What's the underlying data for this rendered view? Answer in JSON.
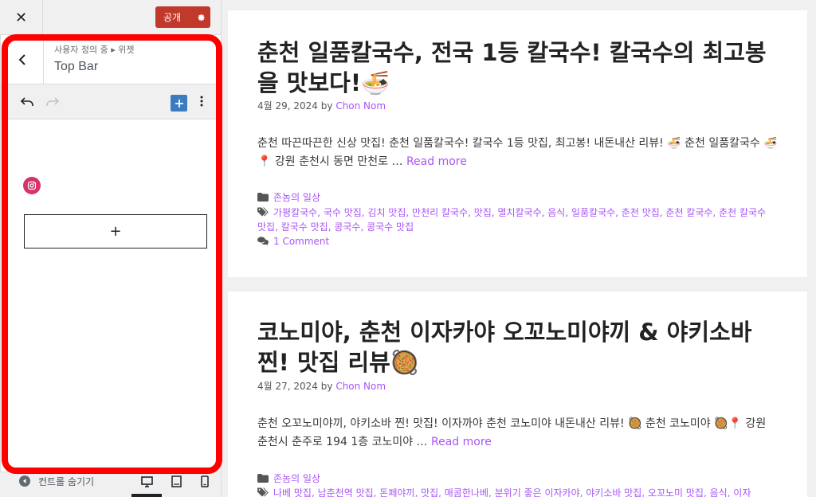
{
  "sidebar": {
    "publish_label": "공개",
    "breadcrumb": "사용자 정의 중 ▸ 위젯",
    "panel_title": "Top Bar",
    "appender_label": "+",
    "collapse_label": "컨트롤 숨기기"
  },
  "posts": [
    {
      "title": "춘천 일품칼국수, 전국 1등 칼국수! 칼국수의 최고봉을 맛보다!🍜",
      "date": "4월 29, 2024",
      "by": "by",
      "author": "Chon Nom",
      "excerpt": "춘천 따끈따끈한 신상 맛집! 춘천 일품칼국수! 칼국수 1등 맛집, 최고봉! 내돈내산 리뷰! 🍜 춘천 일품칼국수 🍜📍 강원 춘천시 동면 만천로 …",
      "read_more": "Read more",
      "category": "존놈의 일상",
      "tags": "가평칼국수, 국수 맛집, 김치 맛집, 만천리 칼국수, 맛집, 멸치칼국수, 음식, 일품칼국수, 춘천 맛집, 춘천 칼국수, 춘천 칼국수 맛집, 칼국수 맛집, 콩국수, 콩국수 맛집",
      "comments": "1 Comment"
    },
    {
      "title": "코노미야, 춘천 이자카야 오꼬노미야끼 & 야키소바 찐! 맛집 리뷰🥘",
      "date": "4월 27, 2024",
      "by": "by",
      "author": "Chon Nom",
      "excerpt": "춘천 오꼬노미야끼, 야키소바 찐! 맛집! 이자까야 춘천 코노미야 내돈내산 리뷰! 🥘 춘천 코노미야 🥘📍 강원 춘천시 춘주로 194 1층 코노미야 …",
      "read_more": "Read more",
      "category": "존놈의 일상",
      "tags": "나베 맛집, 남춘천역 맛집, 돈페야끼, 맛집, 매콤한나베, 분위기 좋은 이자카야, 야키소바 맛집, 오꼬노미 맛집, 음식, 이자"
    }
  ]
}
